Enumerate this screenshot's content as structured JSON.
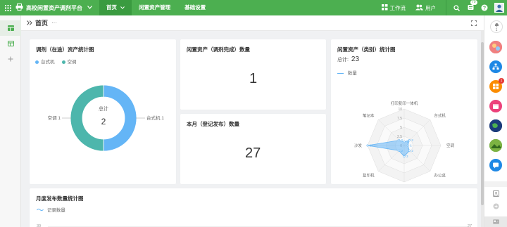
{
  "app": {
    "brand": "高校闲置资产调剂平台",
    "nav": [
      "首页",
      "闲置资产管理",
      "基础设置"
    ],
    "workbench": "工作流",
    "user": "用户",
    "message_count": "70"
  },
  "page": {
    "title": "首页",
    "more": "···"
  },
  "cards": {
    "donut": {
      "title": "调剂（在途）资产统计图",
      "center_label": "总计",
      "center_value": "2",
      "left_label": "空调  1",
      "right_label": "台式机  1"
    },
    "done": {
      "title": "闲置资产（调剂完成）数量",
      "value": "1"
    },
    "monthly": {
      "title": "本月（登记发布）数量",
      "value": "27"
    },
    "radar": {
      "title": "闲置资产（类别）统计图",
      "total_label": "总计:",
      "total_value": "23",
      "legend": "数量"
    },
    "trend": {
      "title": "月度发布数量统计图",
      "legend": "记录数量",
      "left_tick": "30",
      "right_tick": "27"
    }
  },
  "rail": {
    "bell_count": "1",
    "app_badge": "1"
  },
  "colors": {
    "green": "#4caf50",
    "blue": "#64b5f6",
    "teal": "#4db6ac"
  },
  "chart_data": [
    {
      "type": "pie",
      "title": "调剂（在途）资产统计图",
      "categories": [
        "台式机",
        "空调"
      ],
      "values": [
        1,
        1
      ],
      "colors": [
        "#64b5f6",
        "#4db6ac"
      ],
      "total": 2
    },
    {
      "type": "radar",
      "title": "闲置资产（类别）统计图",
      "categories": [
        "打印复印一体机",
        "台式机",
        "空调",
        "办公桌",
        "打印机",
        "复印机",
        "沙发",
        "笔记本"
      ],
      "series": [
        {
          "name": "数量",
          "values": [
            1,
            2,
            1,
            2,
            3,
            2,
            10,
            2
          ]
        }
      ],
      "ticks": [
        "0",
        "2.5",
        "5",
        "7.5",
        "10"
      ],
      "rlim": [
        0,
        10
      ]
    }
  ]
}
